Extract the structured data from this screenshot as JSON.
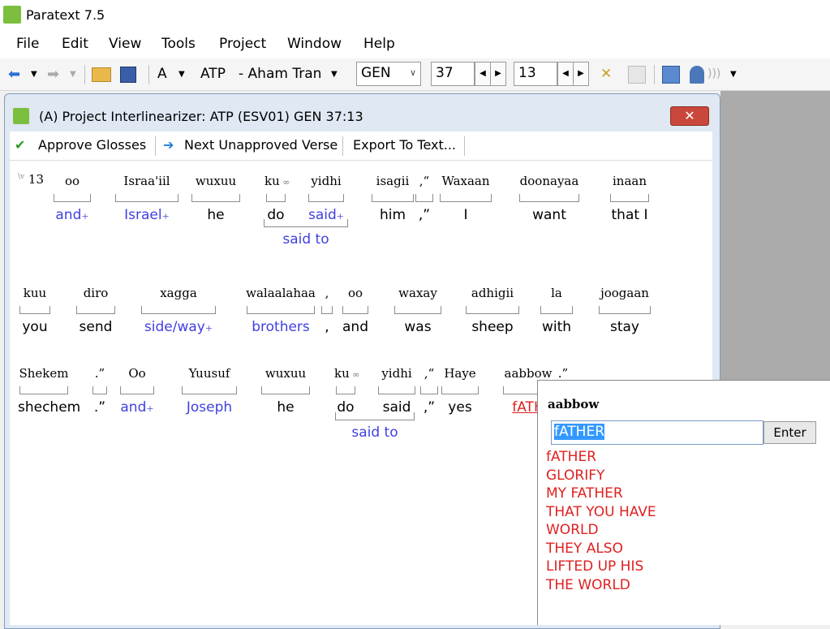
{
  "app": {
    "title": "Paratext 7.5"
  },
  "menu": [
    "File",
    "Edit",
    "View",
    "Tools",
    "Project",
    "Window",
    "Help"
  ],
  "toolbar": {
    "font_letter": "A",
    "project_code": "ATP",
    "project_name": "- Aham Tran",
    "book": "GEN",
    "chapter": "37",
    "verse": "13"
  },
  "window": {
    "title": "(A) Project Interlinearizer: ATP (ESV01) GEN 37:13",
    "close": "✕"
  },
  "subtoolbar": {
    "approve": "Approve Glosses",
    "next": "Next Unapproved Verse",
    "export": "Export To Text..."
  },
  "verse_number": "13",
  "row1": [
    {
      "src": "oo",
      "gloss": "and",
      "g": "b",
      "plus": true
    },
    {
      "src": "Israa'iil",
      "gloss": "Israel",
      "g": "b",
      "plus": true
    },
    {
      "src": "wuxuu",
      "gloss": "he",
      "g": ""
    },
    {
      "src": "ku",
      "gloss": "do",
      "g": "",
      "link": true
    },
    {
      "src": "yidhi",
      "gloss": "said",
      "g": "b",
      "plus": true
    },
    {
      "src": "isagii",
      "gloss": "him",
      "g": ""
    },
    {
      "src": ",“",
      "gloss": ",”",
      "g": ""
    },
    {
      "src": "Waxaan",
      "gloss": "I",
      "g": ""
    },
    {
      "src": "doonayaa",
      "gloss": "want",
      "g": ""
    },
    {
      "src": "inaan",
      "gloss": "that I",
      "g": ""
    }
  ],
  "row1_phrase": "said to",
  "row2": [
    {
      "src": "kuu",
      "gloss": "you",
      "g": ""
    },
    {
      "src": "diro",
      "gloss": "send",
      "g": ""
    },
    {
      "src": "xagga",
      "gloss": "side/way",
      "g": "b",
      "plus": true
    },
    {
      "src": "walaalahaa",
      "gloss": "brothers",
      "g": "b"
    },
    {
      "src": ",",
      "gloss": ",",
      "g": ""
    },
    {
      "src": "oo",
      "gloss": "and",
      "g": ""
    },
    {
      "src": "waxay",
      "gloss": "was",
      "g": ""
    },
    {
      "src": "adhigii",
      "gloss": "sheep",
      "g": ""
    },
    {
      "src": "la",
      "gloss": "with",
      "g": ""
    },
    {
      "src": "joogaan",
      "gloss": "stay",
      "g": ""
    }
  ],
  "row3": [
    {
      "src": "Shekem",
      "gloss": "shechem",
      "g": ""
    },
    {
      "src": ".”",
      "gloss": ".”",
      "g": ""
    },
    {
      "src": "Oo",
      "gloss": "and",
      "g": "b",
      "plus": true
    },
    {
      "src": "Yuusuf",
      "gloss": "Joseph",
      "g": "b"
    },
    {
      "src": "wuxuu",
      "gloss": "he",
      "g": ""
    },
    {
      "src": "ku",
      "gloss": "do",
      "g": "",
      "link": true
    },
    {
      "src": "yidhi",
      "gloss": "said",
      "g": ""
    },
    {
      "src": ",“",
      "gloss": ",”",
      "g": ""
    },
    {
      "src": "Haye",
      "gloss": "yes",
      "g": ""
    },
    {
      "src": "aabbow",
      "gloss": "fATH",
      "g": "r"
    },
    {
      "src": ".”",
      "gloss": "",
      "g": ""
    }
  ],
  "row3_phrase": "said to",
  "popup": {
    "word": "aabbow",
    "input": "fATHER",
    "enter": "Enter",
    "suggestions": [
      "fATHER",
      "GLORIFY",
      "MY FATHER",
      "THAT YOU HAVE",
      "WORLD",
      "THEY ALSO",
      "LIFTED UP HIS",
      "THE WORLD"
    ]
  },
  "colors": {
    "gloss_blue": "#4040e0",
    "gloss_red": "#e02020",
    "selection": "#3399ff"
  }
}
